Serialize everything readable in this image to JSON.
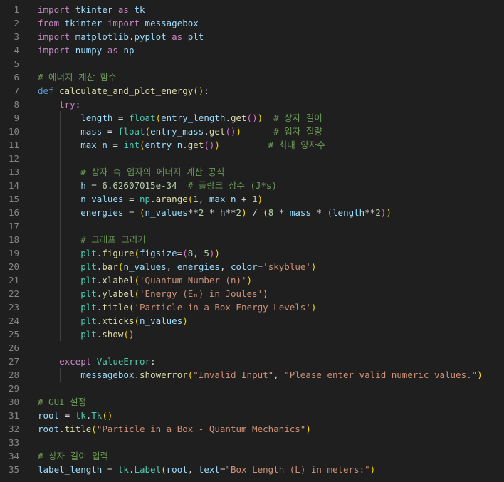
{
  "theme": {
    "background": "#1f1f1f",
    "line_number": "#858585",
    "keyword": "#c586c0",
    "storage": "#569cd6",
    "function": "#dcdcaa",
    "variable": "#9cdcfe",
    "string": "#ce9178",
    "number": "#b5cea8",
    "class": "#4ec9b0",
    "comment": "#6a9955",
    "bracket_1": "#ffd700",
    "bracket_2": "#da70d6",
    "bracket_3": "#179fff"
  },
  "editor": {
    "lines": [
      {
        "n": "1",
        "guides": 0,
        "tokens": [
          [
            "kw",
            "import"
          ],
          [
            "op",
            " "
          ],
          [
            "var",
            "tkinter"
          ],
          [
            "op",
            " "
          ],
          [
            "kw",
            "as"
          ],
          [
            "op",
            " "
          ],
          [
            "var",
            "tk"
          ]
        ]
      },
      {
        "n": "2",
        "guides": 0,
        "tokens": [
          [
            "kw",
            "from"
          ],
          [
            "op",
            " "
          ],
          [
            "var",
            "tkinter"
          ],
          [
            "op",
            " "
          ],
          [
            "kw",
            "import"
          ],
          [
            "op",
            " "
          ],
          [
            "var",
            "messagebox"
          ]
        ]
      },
      {
        "n": "3",
        "guides": 0,
        "tokens": [
          [
            "kw",
            "import"
          ],
          [
            "op",
            " "
          ],
          [
            "var",
            "matplotlib.pyplot"
          ],
          [
            "op",
            " "
          ],
          [
            "kw",
            "as"
          ],
          [
            "op",
            " "
          ],
          [
            "var",
            "plt"
          ]
        ]
      },
      {
        "n": "4",
        "guides": 0,
        "tokens": [
          [
            "kw",
            "import"
          ],
          [
            "op",
            " "
          ],
          [
            "var",
            "numpy"
          ],
          [
            "op",
            " "
          ],
          [
            "kw",
            "as"
          ],
          [
            "op",
            " "
          ],
          [
            "var",
            "np"
          ]
        ]
      },
      {
        "n": "5",
        "guides": 0,
        "tokens": []
      },
      {
        "n": "6",
        "guides": 0,
        "tokens": [
          [
            "cmt",
            "# 에너지 계산 함수"
          ]
        ]
      },
      {
        "n": "7",
        "guides": 0,
        "tokens": [
          [
            "def",
            "def"
          ],
          [
            "op",
            " "
          ],
          [
            "fn",
            "calculate_and_plot_energy"
          ],
          [
            "b1",
            "()"
          ],
          [
            "op",
            ":"
          ]
        ]
      },
      {
        "n": "8",
        "guides": 1,
        "tokens": [
          [
            "op",
            "    "
          ],
          [
            "kw",
            "try"
          ],
          [
            "op",
            ":"
          ]
        ]
      },
      {
        "n": "9",
        "guides": 2,
        "tokens": [
          [
            "op",
            "        "
          ],
          [
            "var",
            "length"
          ],
          [
            "op",
            " = "
          ],
          [
            "cls",
            "float"
          ],
          [
            "b1",
            "("
          ],
          [
            "var",
            "entry_length"
          ],
          [
            "op",
            "."
          ],
          [
            "fn",
            "get"
          ],
          [
            "b2",
            "()"
          ],
          [
            "b1",
            ")"
          ],
          [
            "op",
            "  "
          ],
          [
            "cmt",
            "# 상자 길이"
          ]
        ]
      },
      {
        "n": "10",
        "guides": 2,
        "tokens": [
          [
            "op",
            "        "
          ],
          [
            "var",
            "mass"
          ],
          [
            "op",
            " = "
          ],
          [
            "cls",
            "float"
          ],
          [
            "b1",
            "("
          ],
          [
            "var",
            "entry_mass"
          ],
          [
            "op",
            "."
          ],
          [
            "fn",
            "get"
          ],
          [
            "b2",
            "()"
          ],
          [
            "b1",
            ")"
          ],
          [
            "op",
            "      "
          ],
          [
            "cmt",
            "# 입자 질량"
          ]
        ]
      },
      {
        "n": "11",
        "guides": 2,
        "tokens": [
          [
            "op",
            "        "
          ],
          [
            "var",
            "max_n"
          ],
          [
            "op",
            " = "
          ],
          [
            "cls",
            "int"
          ],
          [
            "b1",
            "("
          ],
          [
            "var",
            "entry_n"
          ],
          [
            "op",
            "."
          ],
          [
            "fn",
            "get"
          ],
          [
            "b2",
            "()"
          ],
          [
            "b1",
            ")"
          ],
          [
            "op",
            "         "
          ],
          [
            "cmt",
            "# 최대 양자수"
          ]
        ]
      },
      {
        "n": "12",
        "guides": 2,
        "tokens": []
      },
      {
        "n": "13",
        "guides": 2,
        "tokens": [
          [
            "op",
            "        "
          ],
          [
            "cmt",
            "# 상자 속 입자의 에너지 계산 공식"
          ]
        ]
      },
      {
        "n": "14",
        "guides": 2,
        "tokens": [
          [
            "op",
            "        "
          ],
          [
            "var",
            "h"
          ],
          [
            "op",
            " = "
          ],
          [
            "num",
            "6.62607015e-34"
          ],
          [
            "op",
            "  "
          ],
          [
            "cmt",
            "# 플랑크 상수 (J*s)"
          ]
        ]
      },
      {
        "n": "15",
        "guides": 2,
        "tokens": [
          [
            "op",
            "        "
          ],
          [
            "var",
            "n_values"
          ],
          [
            "op",
            " = "
          ],
          [
            "cls",
            "np"
          ],
          [
            "op",
            "."
          ],
          [
            "fn",
            "arange"
          ],
          [
            "b1",
            "("
          ],
          [
            "num",
            "1"
          ],
          [
            "op",
            ", "
          ],
          [
            "var",
            "max_n"
          ],
          [
            "op",
            " + "
          ],
          [
            "num",
            "1"
          ],
          [
            "b1",
            ")"
          ]
        ]
      },
      {
        "n": "16",
        "guides": 2,
        "tokens": [
          [
            "op",
            "        "
          ],
          [
            "var",
            "energies"
          ],
          [
            "op",
            " = "
          ],
          [
            "b1",
            "("
          ],
          [
            "var",
            "n_values"
          ],
          [
            "op",
            "**"
          ],
          [
            "num",
            "2"
          ],
          [
            "op",
            " * "
          ],
          [
            "var",
            "h"
          ],
          [
            "op",
            "**"
          ],
          [
            "num",
            "2"
          ],
          [
            "b1",
            ")"
          ],
          [
            "op",
            " / "
          ],
          [
            "b1",
            "("
          ],
          [
            "num",
            "8"
          ],
          [
            "op",
            " * "
          ],
          [
            "var",
            "mass"
          ],
          [
            "op",
            " * "
          ],
          [
            "b2",
            "("
          ],
          [
            "var",
            "length"
          ],
          [
            "op",
            "**"
          ],
          [
            "num",
            "2"
          ],
          [
            "b2",
            ")"
          ],
          [
            "b1",
            ")"
          ]
        ]
      },
      {
        "n": "17",
        "guides": 2,
        "tokens": []
      },
      {
        "n": "18",
        "guides": 2,
        "tokens": [
          [
            "op",
            "        "
          ],
          [
            "cmt",
            "# 그래프 그리기"
          ]
        ]
      },
      {
        "n": "19",
        "guides": 2,
        "tokens": [
          [
            "op",
            "        "
          ],
          [
            "cls",
            "plt"
          ],
          [
            "op",
            "."
          ],
          [
            "fn",
            "figure"
          ],
          [
            "b1",
            "("
          ],
          [
            "var",
            "figsize"
          ],
          [
            "op",
            "="
          ],
          [
            "b2",
            "("
          ],
          [
            "num",
            "8"
          ],
          [
            "op",
            ", "
          ],
          [
            "num",
            "5"
          ],
          [
            "b2",
            ")"
          ],
          [
            "b1",
            ")"
          ]
        ]
      },
      {
        "n": "20",
        "guides": 2,
        "tokens": [
          [
            "op",
            "        "
          ],
          [
            "cls",
            "plt"
          ],
          [
            "op",
            "."
          ],
          [
            "fn",
            "bar"
          ],
          [
            "b1",
            "("
          ],
          [
            "var",
            "n_values"
          ],
          [
            "op",
            ", "
          ],
          [
            "var",
            "energies"
          ],
          [
            "op",
            ", "
          ],
          [
            "var",
            "color"
          ],
          [
            "op",
            "="
          ],
          [
            "str",
            "'skyblue'"
          ],
          [
            "b1",
            ")"
          ]
        ]
      },
      {
        "n": "21",
        "guides": 2,
        "tokens": [
          [
            "op",
            "        "
          ],
          [
            "cls",
            "plt"
          ],
          [
            "op",
            "."
          ],
          [
            "fn",
            "xlabel"
          ],
          [
            "b1",
            "("
          ],
          [
            "str",
            "'Quantum Number (n)'"
          ],
          [
            "b1",
            ")"
          ]
        ]
      },
      {
        "n": "22",
        "guides": 2,
        "tokens": [
          [
            "op",
            "        "
          ],
          [
            "cls",
            "plt"
          ],
          [
            "op",
            "."
          ],
          [
            "fn",
            "ylabel"
          ],
          [
            "b1",
            "("
          ],
          [
            "str",
            "'Energy (Eₙ) in Joules'"
          ],
          [
            "b1",
            ")"
          ]
        ]
      },
      {
        "n": "23",
        "guides": 2,
        "tokens": [
          [
            "op",
            "        "
          ],
          [
            "cls",
            "plt"
          ],
          [
            "op",
            "."
          ],
          [
            "fn",
            "title"
          ],
          [
            "b1",
            "("
          ],
          [
            "str",
            "'Particle in a Box Energy Levels'"
          ],
          [
            "b1",
            ")"
          ]
        ]
      },
      {
        "n": "24",
        "guides": 2,
        "tokens": [
          [
            "op",
            "        "
          ],
          [
            "cls",
            "plt"
          ],
          [
            "op",
            "."
          ],
          [
            "fn",
            "xticks"
          ],
          [
            "b1",
            "("
          ],
          [
            "var",
            "n_values"
          ],
          [
            "b1",
            ")"
          ]
        ]
      },
      {
        "n": "25",
        "guides": 2,
        "tokens": [
          [
            "op",
            "        "
          ],
          [
            "cls",
            "plt"
          ],
          [
            "op",
            "."
          ],
          [
            "fn",
            "show"
          ],
          [
            "b1",
            "()"
          ]
        ]
      },
      {
        "n": "26",
        "guides": 1,
        "tokens": []
      },
      {
        "n": "27",
        "guides": 1,
        "tokens": [
          [
            "op",
            "    "
          ],
          [
            "kw",
            "except"
          ],
          [
            "op",
            " "
          ],
          [
            "cls",
            "ValueError"
          ],
          [
            "op",
            ":"
          ]
        ]
      },
      {
        "n": "28",
        "guides": 2,
        "tokens": [
          [
            "op",
            "        "
          ],
          [
            "var",
            "messagebox"
          ],
          [
            "op",
            "."
          ],
          [
            "fn",
            "showerror"
          ],
          [
            "b1",
            "("
          ],
          [
            "str",
            "\"Invalid Input\""
          ],
          [
            "op",
            ", "
          ],
          [
            "str",
            "\"Please enter valid numeric values.\""
          ],
          [
            "b1",
            ")"
          ]
        ]
      },
      {
        "n": "29",
        "guides": 0,
        "tokens": []
      },
      {
        "n": "30",
        "guides": 0,
        "tokens": [
          [
            "cmt",
            "# GUI 설정"
          ]
        ]
      },
      {
        "n": "31",
        "guides": 0,
        "tokens": [
          [
            "var",
            "root"
          ],
          [
            "op",
            " = "
          ],
          [
            "cls",
            "tk"
          ],
          [
            "op",
            "."
          ],
          [
            "cls",
            "Tk"
          ],
          [
            "b1",
            "()"
          ]
        ]
      },
      {
        "n": "32",
        "guides": 0,
        "tokens": [
          [
            "var",
            "root"
          ],
          [
            "op",
            "."
          ],
          [
            "fn",
            "title"
          ],
          [
            "b1",
            "("
          ],
          [
            "str",
            "\"Particle in a Box - Quantum Mechanics\""
          ],
          [
            "b1",
            ")"
          ]
        ]
      },
      {
        "n": "33",
        "guides": 0,
        "tokens": []
      },
      {
        "n": "34",
        "guides": 0,
        "tokens": [
          [
            "cmt",
            "# 상자 길이 입력"
          ]
        ]
      },
      {
        "n": "35",
        "guides": 0,
        "tokens": [
          [
            "var",
            "label_length"
          ],
          [
            "op",
            " = "
          ],
          [
            "cls",
            "tk"
          ],
          [
            "op",
            "."
          ],
          [
            "cls",
            "Label"
          ],
          [
            "b1",
            "("
          ],
          [
            "var",
            "root"
          ],
          [
            "op",
            ", "
          ],
          [
            "var",
            "text"
          ],
          [
            "op",
            "="
          ],
          [
            "str",
            "\"Box Length (L) in meters:\""
          ],
          [
            "b1",
            ")"
          ]
        ]
      }
    ]
  }
}
